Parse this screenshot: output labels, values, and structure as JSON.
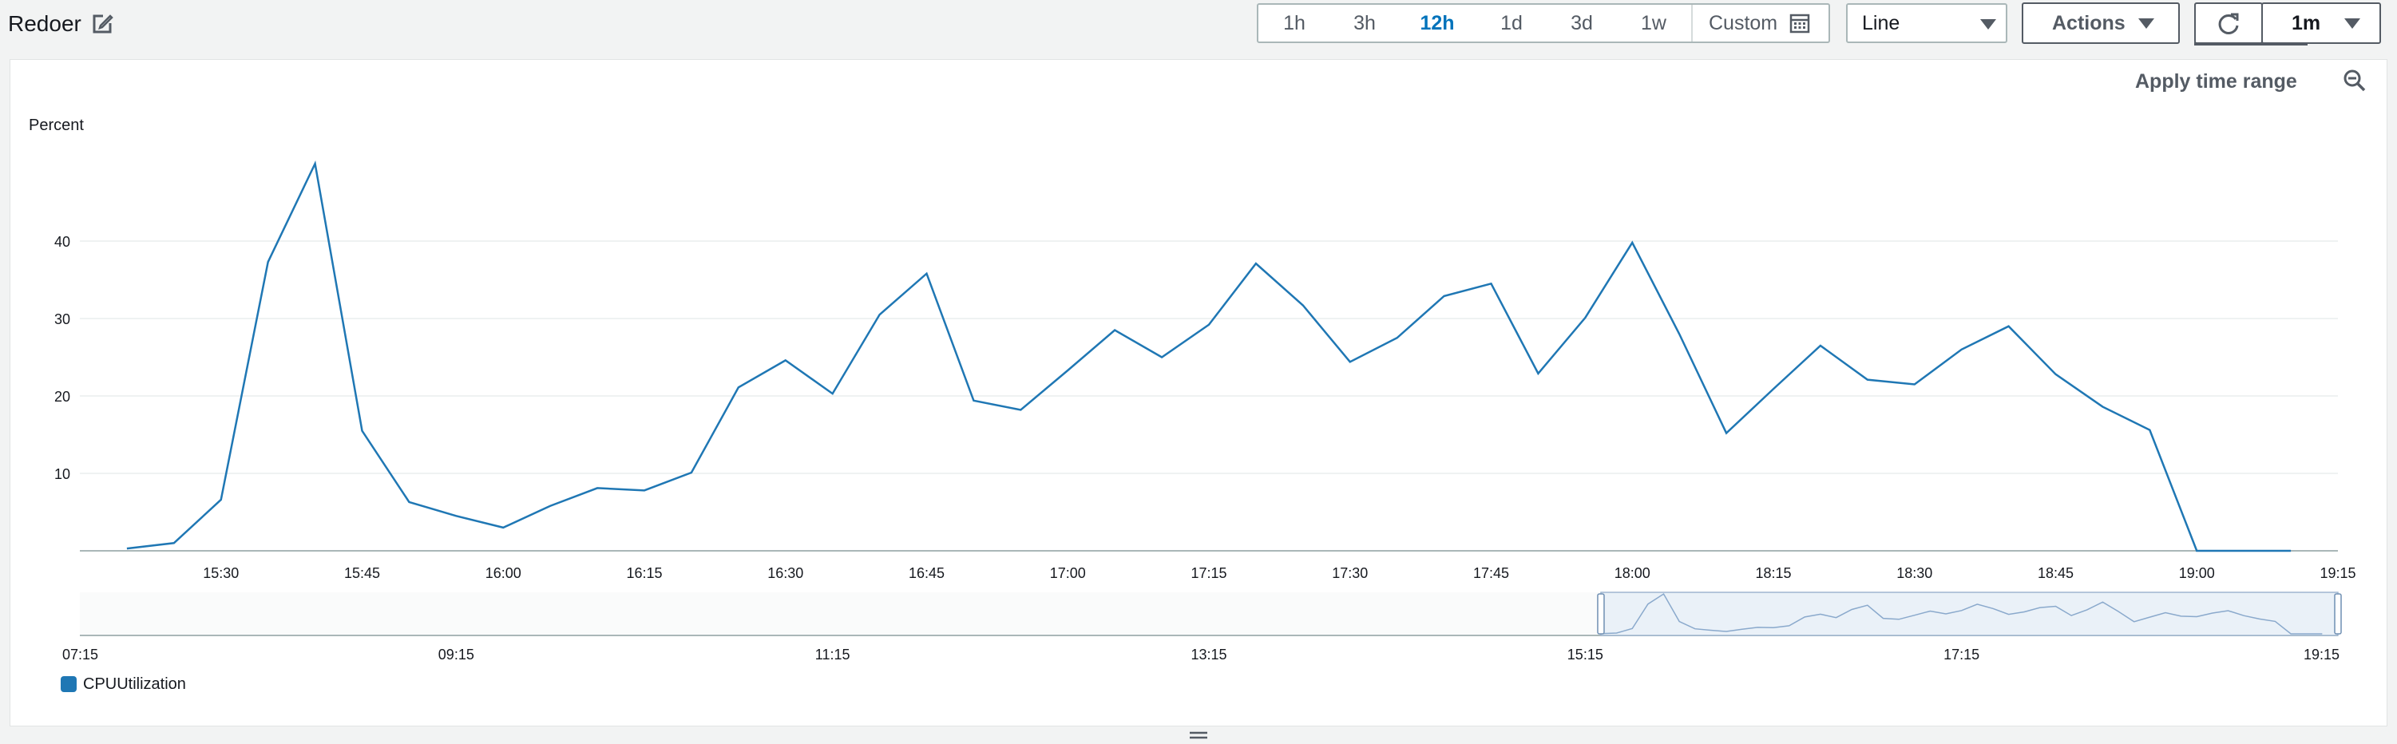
{
  "header": {
    "title": "Redoer",
    "edit_icon": "edit-icon"
  },
  "time_range": {
    "options": [
      "1h",
      "3h",
      "12h",
      "1d",
      "3d",
      "1w"
    ],
    "selected": "12h",
    "custom_label": "Custom",
    "custom_icon": "calendar-icon"
  },
  "chart_type_select": {
    "value": "Line"
  },
  "actions_button": {
    "label": "Actions"
  },
  "refresh": {
    "icon": "refresh-icon",
    "interval": "1m"
  },
  "panel": {
    "apply_label": "Apply time range",
    "zoom_icon": "zoom-out-icon"
  },
  "colors": {
    "series": "#1f77b4",
    "active_range": "#0073bb",
    "overview_band": "#eaf1f8"
  },
  "chart_data": {
    "type": "line",
    "ylabel": "Percent",
    "ylim": [
      0,
      50
    ],
    "y_ticks": [
      10,
      20,
      30,
      40
    ],
    "grid": true,
    "x_ticks": [
      "15:30",
      "15:45",
      "16:00",
      "16:15",
      "16:30",
      "16:45",
      "17:00",
      "17:15",
      "17:30",
      "17:45",
      "18:00",
      "18:15",
      "18:30",
      "18:45",
      "19:00",
      "19:15"
    ],
    "series": [
      {
        "name": "CPUUtilization",
        "x": [
          "15:20",
          "15:25",
          "15:30",
          "15:35",
          "15:40",
          "15:45",
          "15:50",
          "15:55",
          "16:00",
          "16:05",
          "16:10",
          "16:15",
          "16:20",
          "16:25",
          "16:30",
          "16:35",
          "16:40",
          "16:45",
          "16:50",
          "16:55",
          "17:00",
          "17:05",
          "17:10",
          "17:15",
          "17:20",
          "17:25",
          "17:30",
          "17:35",
          "17:40",
          "17:45",
          "17:50",
          "17:55",
          "18:00",
          "18:05",
          "18:10",
          "18:15",
          "18:20",
          "18:25",
          "18:30",
          "18:35",
          "18:40",
          "18:45",
          "18:50",
          "18:55",
          "19:00",
          "19:05",
          "19:10"
        ],
        "values": [
          0.3,
          1,
          6.6,
          37.3,
          50,
          15.5,
          6.3,
          4.5,
          3,
          5.8,
          8.1,
          7.8,
          10.1,
          21.1,
          24.6,
          20.3,
          30.5,
          35.8,
          19.4,
          18.2,
          23.3,
          28.5,
          25,
          29.2,
          37.1,
          31.7,
          24.4,
          27.5,
          32.9,
          34.5,
          22.9,
          30.1,
          39.8,
          28,
          15.2,
          20.9,
          26.5,
          22.1,
          21.5,
          26,
          29,
          22.8,
          18.6,
          15.6,
          0,
          0,
          0
        ]
      }
    ],
    "overview": {
      "x_ticks": [
        "07:15",
        "09:15",
        "11:15",
        "13:15",
        "15:15",
        "17:15",
        "19:15"
      ],
      "selection": [
        "15:20",
        "19:15"
      ]
    },
    "legend": "bottom-left"
  }
}
